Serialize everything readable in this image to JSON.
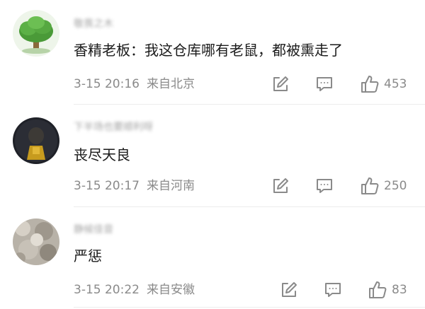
{
  "comments": [
    {
      "username": "敬畏之木",
      "text": "香精老板：我这仓库哪有老鼠，都被熏走了",
      "time": "3-15 20:16",
      "location": "来自北京",
      "likes": "453",
      "avatar_icon": "tree-icon"
    },
    {
      "username": "下半场也要顺利呀",
      "text": "丧尽天良",
      "time": "3-15 20:17",
      "location": "来自河南",
      "likes": "250",
      "avatar_icon": "person-icon"
    },
    {
      "username": "静候佳音",
      "text": "严惩",
      "time": "3-15 20:22",
      "location": "来自安徽",
      "likes": "83",
      "avatar_icon": "photo-icon"
    }
  ],
  "colors": {
    "text_primary": "#1a1a1a",
    "text_secondary": "#8a8a8a",
    "divider": "#ececec"
  }
}
